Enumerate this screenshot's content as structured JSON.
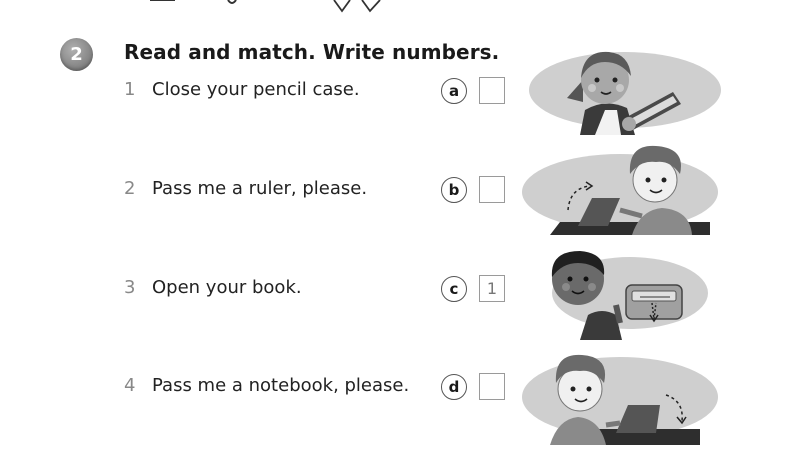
{
  "exercise": {
    "number": "2",
    "title": "Read and match. Write numbers."
  },
  "items": [
    {
      "num": "1",
      "text": "Close your pencil case."
    },
    {
      "num": "2",
      "text": "Pass me a ruler, please."
    },
    {
      "num": "3",
      "text": "Open your book."
    },
    {
      "num": "4",
      "text": "Pass me a notebook, please."
    }
  ],
  "answers": [
    {
      "letter": "a",
      "value": ""
    },
    {
      "letter": "b",
      "value": ""
    },
    {
      "letter": "c",
      "value": "1"
    },
    {
      "letter": "d",
      "value": ""
    }
  ],
  "pictures": [
    {
      "letter": "a",
      "icon": "girl-holding-notebook-illustration"
    },
    {
      "letter": "b",
      "icon": "boy-closing-book-illustration"
    },
    {
      "letter": "c",
      "icon": "boy-holding-pencil-case-illustration"
    },
    {
      "letter": "d",
      "icon": "boy-opening-book-illustration"
    }
  ]
}
